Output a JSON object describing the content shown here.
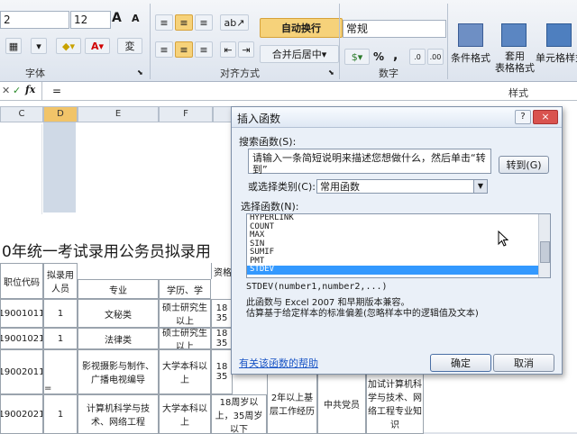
{
  "ribbon": {
    "font_size_left": "2",
    "font_size": "12",
    "font_group_label": "字体",
    "align_group_label": "对齐方式",
    "wrap_text": "自动换行",
    "merge_center": "合并后居中",
    "number_format": "常规",
    "number_group_label": "数字",
    "conditional_format": "条件格式",
    "table_format": "套用\n表格格式",
    "cell_style": "单元格样式",
    "style_group_label": "样式",
    "grow_font_label": "A",
    "shrink_font_label": "A",
    "percent_label": "%",
    "comma_label": ","
  },
  "formula_bar": {
    "fx_label": "fx",
    "content": "="
  },
  "sheet": {
    "columns": [
      "C",
      "D",
      "E",
      "F"
    ],
    "selected_column": "D",
    "title_text": "0年统一考试录用公务员拟录用",
    "header_partial": "资格",
    "headers": [
      "职位代码",
      "拟录用人员",
      "专业",
      "学历、学"
    ],
    "rows": [
      {
        "code": "19001011",
        "count": "1",
        "major": "文秘类",
        "edu": "硕士研究生以上",
        "extra": "18 35"
      },
      {
        "code": "19001021",
        "count": "1",
        "major": "法律类",
        "edu": "硕士研究生以上",
        "extra": "18 35"
      },
      {
        "code": "19002011",
        "count": "=",
        "major": "影视摄影与制作、广播电视编导",
        "edu": "大学本科以上",
        "extra": "18 35"
      },
      {
        "code": "19002021",
        "count": "1",
        "major": "计算机科学与技术、网络工程",
        "edu": "大学本科以上",
        "extra": "18周岁以上，35周岁以下",
        "c6": "2年以上基层工作经历",
        "c7": "中共党员",
        "c8": "加试计算机科学与技术、网络工程专业知识"
      }
    ]
  },
  "dialog": {
    "title": "插入函数",
    "search_label": "搜索函数(S):",
    "search_text": "请输入一条简短说明来描述您想做什么，然后单击“转到”",
    "go_button": "转到(G)",
    "category_label": "或选择类别(C):",
    "category_value": "常用函数",
    "select_label": "选择函数(N):",
    "functions": [
      "HYPERLINK",
      "COUNT",
      "MAX",
      "SIN",
      "SUMIF",
      "PMT",
      "STDEV"
    ],
    "selected_function": "STDEV",
    "signature": "STDEV(number1,number2,...)",
    "desc1": "此函数与 Excel 2007 和早期版本兼容。",
    "desc2": "估算基于给定样本的标准偏差(忽略样本中的逻辑值及文本)",
    "help_link": "有关该函数的帮助",
    "ok_button": "确定",
    "cancel_button": "取消",
    "close_label": "×",
    "help_icon_label": "?"
  }
}
